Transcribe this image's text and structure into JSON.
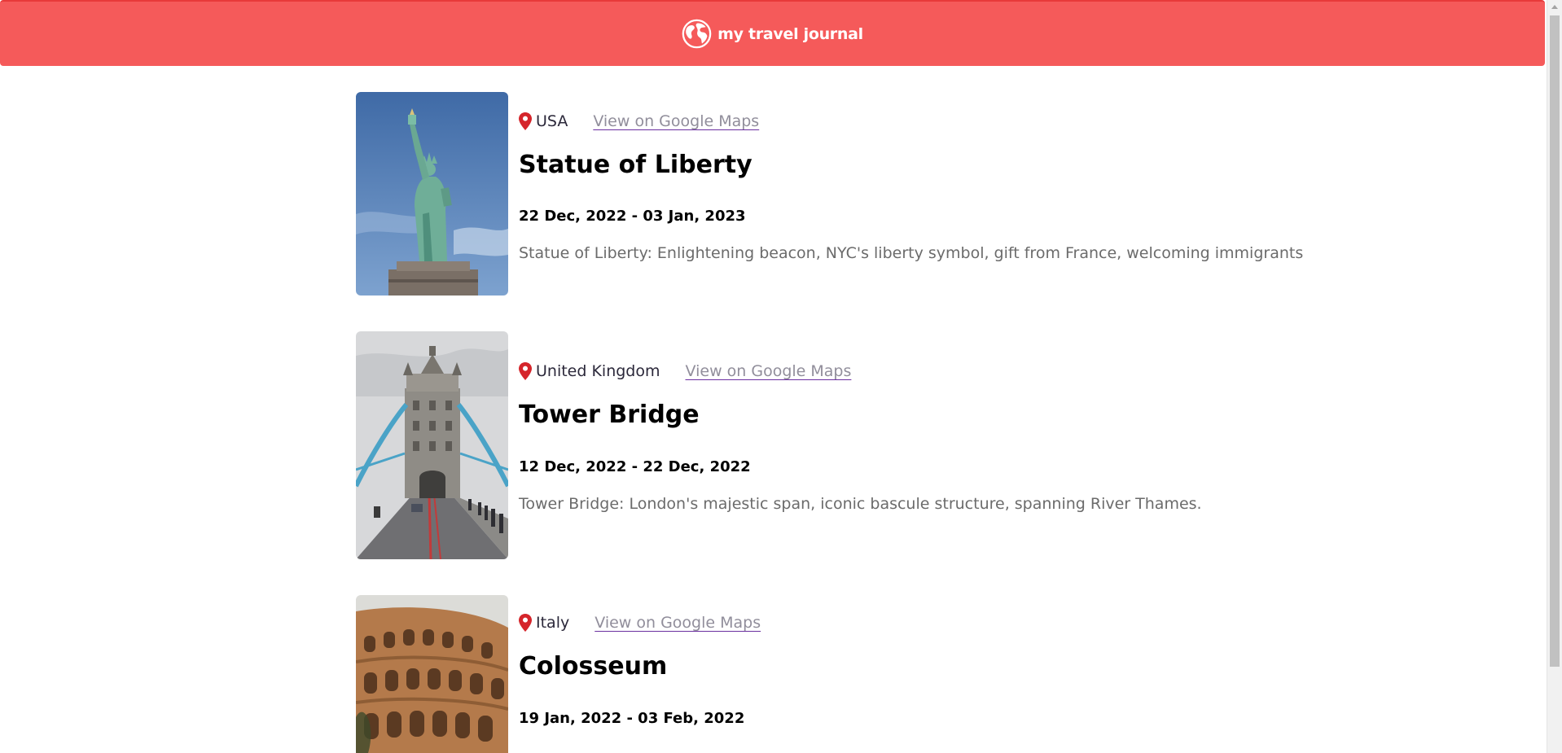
{
  "header": {
    "title": "my travel journal",
    "icon": "globe-icon",
    "background": "#F55A5A"
  },
  "entries": [
    {
      "country": "USA",
      "maps_link": "View on Google Maps",
      "title": "Statue of Liberty",
      "dates": "22 Dec, 2022 - 03 Jan, 2023",
      "description": "Statue of Liberty: Enlightening beacon, NYC's liberty symbol, gift from France, welcoming immigrants",
      "image": "statue-of-liberty-photo"
    },
    {
      "country": "United Kingdom",
      "maps_link": "View on Google Maps",
      "title": "Tower Bridge",
      "dates": "12 Dec, 2022 - 22 Dec, 2022",
      "description": "Tower Bridge: London's majestic span, iconic bascule structure, spanning River Thames.",
      "image": "tower-bridge-photo"
    },
    {
      "country": "Italy",
      "maps_link": "View on Google Maps",
      "title": "Colosseum",
      "dates": "19 Jan, 2022 - 03 Feb, 2022",
      "description": "",
      "image": "colosseum-photo"
    }
  ],
  "colors": {
    "accent": "#F55A5A",
    "pin": "#D5252B",
    "link": "#918E9B",
    "link_underline": "#6b2fa0",
    "description": "#6b6b6b"
  }
}
